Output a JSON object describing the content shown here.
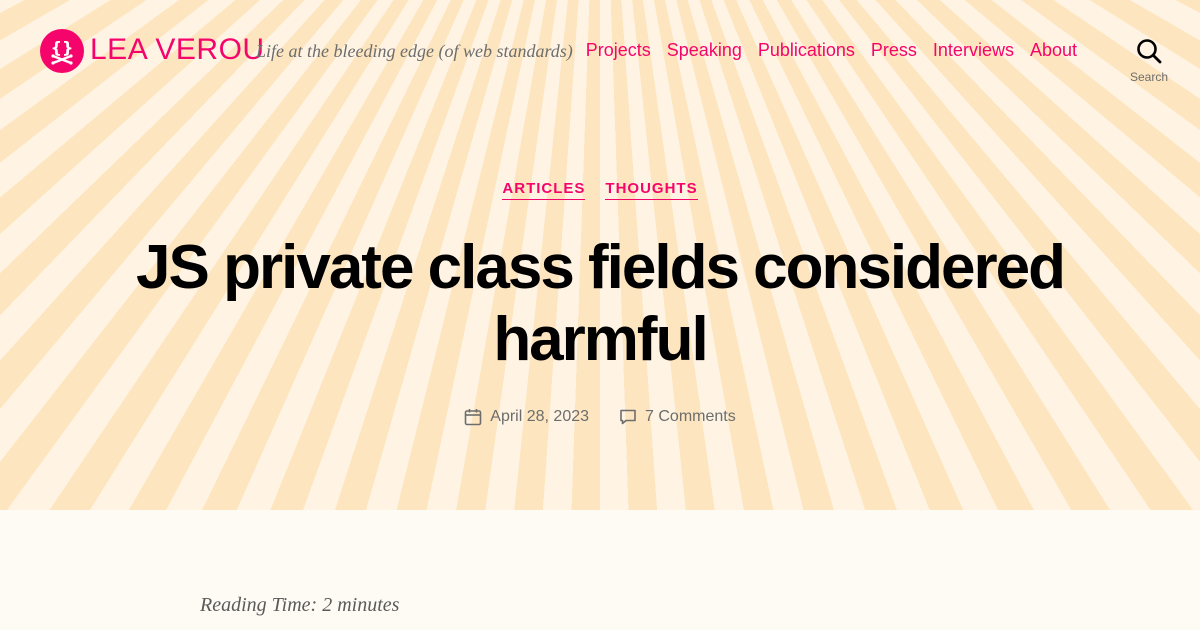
{
  "site": {
    "title": "LEA VEROU",
    "tagline": "Life at the bleeding edge (of web standards)",
    "logo_icon": "braces-crossbones-icon",
    "accent_color": "#f5056b"
  },
  "nav": {
    "items": [
      {
        "label": "Projects"
      },
      {
        "label": "Speaking"
      },
      {
        "label": "Publications"
      },
      {
        "label": "Press"
      },
      {
        "label": "Interviews"
      },
      {
        "label": "About"
      }
    ]
  },
  "search": {
    "label": "Search",
    "icon": "search-icon"
  },
  "post": {
    "categories": [
      "ARTICLES",
      "THOUGHTS"
    ],
    "title": "JS private class fields considered harmful",
    "date": "April 28, 2023",
    "comments": "7 Comments",
    "reading_time": "Reading Time: 2 minutes"
  }
}
